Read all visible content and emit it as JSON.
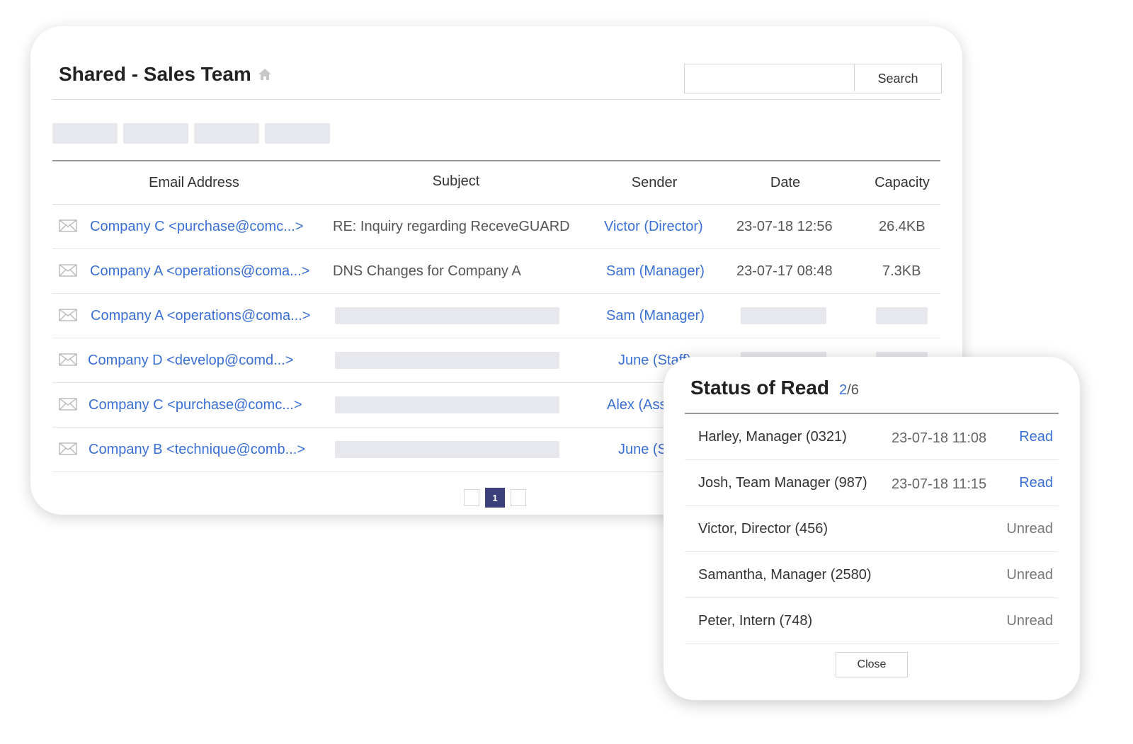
{
  "header": {
    "title": "Shared - Sales Team",
    "search_value": "",
    "search_label": "Search"
  },
  "columns": {
    "email": "Email Address",
    "subject": "Subject",
    "sender": "Sender",
    "date": "Date",
    "capacity": "Capacity"
  },
  "rows": [
    {
      "email": "Company C <purchase@comc...>",
      "subject": "RE: Inquiry regarding ReceveGUARD",
      "sender": "Victor (Director)",
      "date": "23-07-18 12:56",
      "capacity": "26.4KB"
    },
    {
      "email": "Company A <operations@coma...>",
      "subject": "DNS Changes for Company A",
      "sender": "Sam (Manager)",
      "date": "23-07-17 08:48",
      "capacity": "7.3KB"
    },
    {
      "email": "Company A <operations@coma...>",
      "subject": "",
      "sender": "Sam (Manager)",
      "date": "",
      "capacity": ""
    },
    {
      "email": "Company D <develop@comd...>",
      "subject": "",
      "sender": "June (Staff)",
      "date": "",
      "capacity": ""
    },
    {
      "email": "Company C <purchase@comc...>",
      "subject": "",
      "sender": "Alex (Ass",
      "date": "",
      "capacity": ""
    },
    {
      "email": "Company B <technique@comb...>",
      "subject": "",
      "sender": "June (S",
      "date": "",
      "capacity": ""
    }
  ],
  "pagination": {
    "current": "1"
  },
  "status_modal": {
    "title": "Status of Read",
    "read_count": "2",
    "total": "/6",
    "entries": [
      {
        "name": "Harley, Manager (0321)",
        "date": "23-07-18 11:08",
        "status": "Read"
      },
      {
        "name": "Josh, Team Manager (987)",
        "date": "23-07-18 11:15",
        "status": "Read"
      },
      {
        "name": "Victor, Director (456)",
        "date": "",
        "status": "Unread"
      },
      {
        "name": "Samantha, Manager (2580)",
        "date": "",
        "status": "Unread"
      },
      {
        "name": "Peter, Intern (748)",
        "date": "",
        "status": "Unread"
      }
    ],
    "close_label": "Close"
  },
  "colors": {
    "link": "#3a6fd6",
    "pager_active": "#3b3f7a",
    "placeholder": "#e6e8ee"
  },
  "icons": {
    "title": "home-icon",
    "row": "mail-icon"
  }
}
